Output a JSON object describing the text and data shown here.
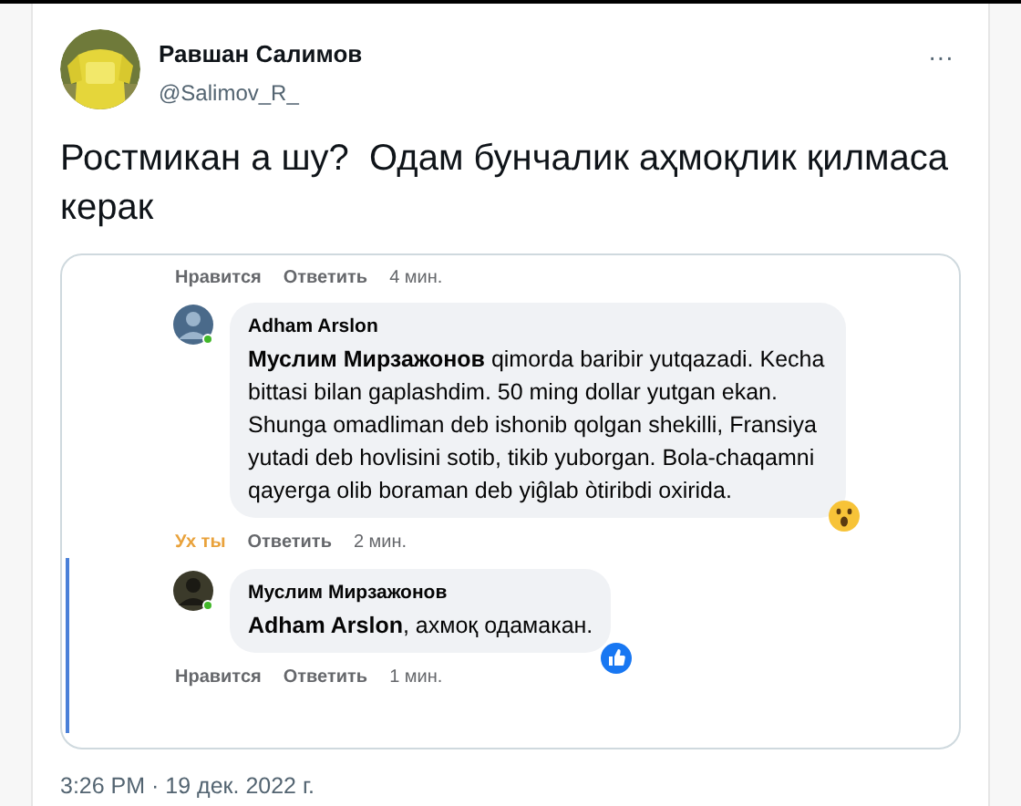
{
  "tweet": {
    "author": "Равшан Салимов",
    "handle": "@Salimov_R_",
    "text": "Ростмикан а шу?  Одам бунчалик аҳмоқлик қилмаса керак",
    "more": "···",
    "embedded_screenshot": {
      "items": [
        {
          "kind": "actions",
          "like_label": "Нравится",
          "liked": false,
          "reply_label": "Ответить",
          "time": "4 мин."
        },
        {
          "kind": "comment",
          "author": "Adham Arslon",
          "text": "**Муслим Мирзажонов** qimorda baribir yutqazadi. Kecha bittasi bilan gaplashdim. 50 ming dollar yutgan ekan. Shunga omadliman deb ishonib qolgan shekilli, Fransiya yutadi deb hovlisini sotib, tikib yuborgan. Bola-chaqamni qayerga olib boraman deb yiĝlab òtiribdi oxirida.",
          "reaction": {
            "kind": "wow"
          }
        },
        {
          "kind": "actions",
          "like_label": "Ух ты",
          "liked": true,
          "reply_label": "Ответить",
          "time": "2 мин."
        },
        {
          "kind": "comment",
          "author": "Муслим Мирзажонов",
          "text": "**Adham Arslon**, ахмоқ одамакан.",
          "reaction": {
            "kind": "like"
          }
        },
        {
          "kind": "actions",
          "like_label": "Нравится",
          "liked": false,
          "reply_label": "Ответить",
          "time": "1 мин."
        }
      ]
    },
    "timestamp": "3:26 PM · 19 дек. 2022 г."
  }
}
